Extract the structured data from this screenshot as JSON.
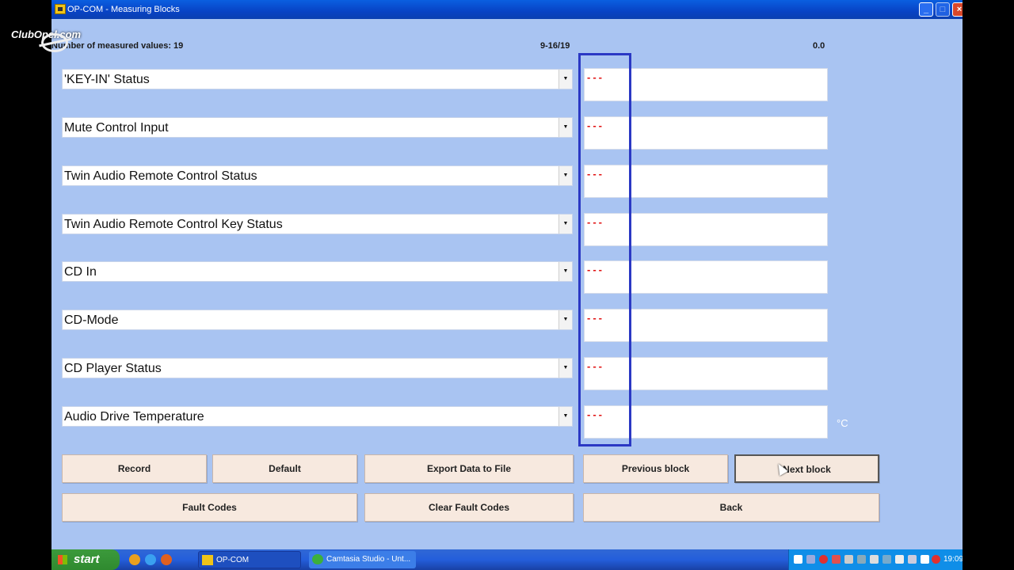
{
  "window": {
    "title": "OP-COM - Measuring Blocks",
    "min": "_",
    "max": "□",
    "close": "×"
  },
  "watermark": "ClubOpel.com",
  "header": {
    "measured_count": "Number of measured values: 19",
    "block_range": "9-16/19",
    "readout": "0.0"
  },
  "rows": [
    {
      "label": "'KEY-IN' Status",
      "value": "---"
    },
    {
      "label": "Mute Control Input",
      "value": "---"
    },
    {
      "label": "Twin Audio Remote Control Status",
      "value": "---"
    },
    {
      "label": "Twin Audio Remote Control Key Status",
      "value": "---"
    },
    {
      "label": "CD In",
      "value": "---"
    },
    {
      "label": "CD-Mode",
      "value": "---"
    },
    {
      "label": "CD Player Status",
      "value": "---"
    },
    {
      "label": "Audio Drive Temperature",
      "value": "---"
    }
  ],
  "unit_celsius": "°C",
  "dropdown_glyph": "▼",
  "buttons": {
    "record": "Record",
    "default": "Default",
    "export": "Export Data to File",
    "previous": "Previous block",
    "next": "Next block",
    "fault_codes": "Fault Codes",
    "clear_fault_codes": "Clear Fault Codes",
    "back": "Back"
  },
  "taskbar": {
    "start": "start",
    "tasks": [
      "OP-COM",
      "Camtasia Studio - Unt..."
    ],
    "clock": "19:09"
  },
  "colors": {
    "window_bg": "#a9c4f2",
    "highlight_border": "#2b38c4",
    "value_text": "#e01010"
  }
}
